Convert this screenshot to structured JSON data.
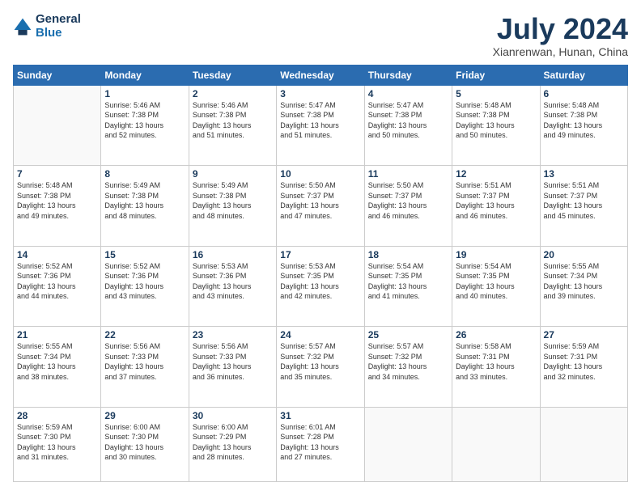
{
  "header": {
    "logo_line1": "General",
    "logo_line2": "Blue",
    "month": "July 2024",
    "location": "Xianrenwan, Hunan, China"
  },
  "weekdays": [
    "Sunday",
    "Monday",
    "Tuesday",
    "Wednesday",
    "Thursday",
    "Friday",
    "Saturday"
  ],
  "weeks": [
    [
      {
        "day": "",
        "info": ""
      },
      {
        "day": "1",
        "info": "Sunrise: 5:46 AM\nSunset: 7:38 PM\nDaylight: 13 hours\nand 52 minutes."
      },
      {
        "day": "2",
        "info": "Sunrise: 5:46 AM\nSunset: 7:38 PM\nDaylight: 13 hours\nand 51 minutes."
      },
      {
        "day": "3",
        "info": "Sunrise: 5:47 AM\nSunset: 7:38 PM\nDaylight: 13 hours\nand 51 minutes."
      },
      {
        "day": "4",
        "info": "Sunrise: 5:47 AM\nSunset: 7:38 PM\nDaylight: 13 hours\nand 50 minutes."
      },
      {
        "day": "5",
        "info": "Sunrise: 5:48 AM\nSunset: 7:38 PM\nDaylight: 13 hours\nand 50 minutes."
      },
      {
        "day": "6",
        "info": "Sunrise: 5:48 AM\nSunset: 7:38 PM\nDaylight: 13 hours\nand 49 minutes."
      }
    ],
    [
      {
        "day": "7",
        "info": "Sunrise: 5:48 AM\nSunset: 7:38 PM\nDaylight: 13 hours\nand 49 minutes."
      },
      {
        "day": "8",
        "info": "Sunrise: 5:49 AM\nSunset: 7:38 PM\nDaylight: 13 hours\nand 48 minutes."
      },
      {
        "day": "9",
        "info": "Sunrise: 5:49 AM\nSunset: 7:38 PM\nDaylight: 13 hours\nand 48 minutes."
      },
      {
        "day": "10",
        "info": "Sunrise: 5:50 AM\nSunset: 7:37 PM\nDaylight: 13 hours\nand 47 minutes."
      },
      {
        "day": "11",
        "info": "Sunrise: 5:50 AM\nSunset: 7:37 PM\nDaylight: 13 hours\nand 46 minutes."
      },
      {
        "day": "12",
        "info": "Sunrise: 5:51 AM\nSunset: 7:37 PM\nDaylight: 13 hours\nand 46 minutes."
      },
      {
        "day": "13",
        "info": "Sunrise: 5:51 AM\nSunset: 7:37 PM\nDaylight: 13 hours\nand 45 minutes."
      }
    ],
    [
      {
        "day": "14",
        "info": "Sunrise: 5:52 AM\nSunset: 7:36 PM\nDaylight: 13 hours\nand 44 minutes."
      },
      {
        "day": "15",
        "info": "Sunrise: 5:52 AM\nSunset: 7:36 PM\nDaylight: 13 hours\nand 43 minutes."
      },
      {
        "day": "16",
        "info": "Sunrise: 5:53 AM\nSunset: 7:36 PM\nDaylight: 13 hours\nand 43 minutes."
      },
      {
        "day": "17",
        "info": "Sunrise: 5:53 AM\nSunset: 7:35 PM\nDaylight: 13 hours\nand 42 minutes."
      },
      {
        "day": "18",
        "info": "Sunrise: 5:54 AM\nSunset: 7:35 PM\nDaylight: 13 hours\nand 41 minutes."
      },
      {
        "day": "19",
        "info": "Sunrise: 5:54 AM\nSunset: 7:35 PM\nDaylight: 13 hours\nand 40 minutes."
      },
      {
        "day": "20",
        "info": "Sunrise: 5:55 AM\nSunset: 7:34 PM\nDaylight: 13 hours\nand 39 minutes."
      }
    ],
    [
      {
        "day": "21",
        "info": "Sunrise: 5:55 AM\nSunset: 7:34 PM\nDaylight: 13 hours\nand 38 minutes."
      },
      {
        "day": "22",
        "info": "Sunrise: 5:56 AM\nSunset: 7:33 PM\nDaylight: 13 hours\nand 37 minutes."
      },
      {
        "day": "23",
        "info": "Sunrise: 5:56 AM\nSunset: 7:33 PM\nDaylight: 13 hours\nand 36 minutes."
      },
      {
        "day": "24",
        "info": "Sunrise: 5:57 AM\nSunset: 7:32 PM\nDaylight: 13 hours\nand 35 minutes."
      },
      {
        "day": "25",
        "info": "Sunrise: 5:57 AM\nSunset: 7:32 PM\nDaylight: 13 hours\nand 34 minutes."
      },
      {
        "day": "26",
        "info": "Sunrise: 5:58 AM\nSunset: 7:31 PM\nDaylight: 13 hours\nand 33 minutes."
      },
      {
        "day": "27",
        "info": "Sunrise: 5:59 AM\nSunset: 7:31 PM\nDaylight: 13 hours\nand 32 minutes."
      }
    ],
    [
      {
        "day": "28",
        "info": "Sunrise: 5:59 AM\nSunset: 7:30 PM\nDaylight: 13 hours\nand 31 minutes."
      },
      {
        "day": "29",
        "info": "Sunrise: 6:00 AM\nSunset: 7:30 PM\nDaylight: 13 hours\nand 30 minutes."
      },
      {
        "day": "30",
        "info": "Sunrise: 6:00 AM\nSunset: 7:29 PM\nDaylight: 13 hours\nand 28 minutes."
      },
      {
        "day": "31",
        "info": "Sunrise: 6:01 AM\nSunset: 7:28 PM\nDaylight: 13 hours\nand 27 minutes."
      },
      {
        "day": "",
        "info": ""
      },
      {
        "day": "",
        "info": ""
      },
      {
        "day": "",
        "info": ""
      }
    ]
  ]
}
